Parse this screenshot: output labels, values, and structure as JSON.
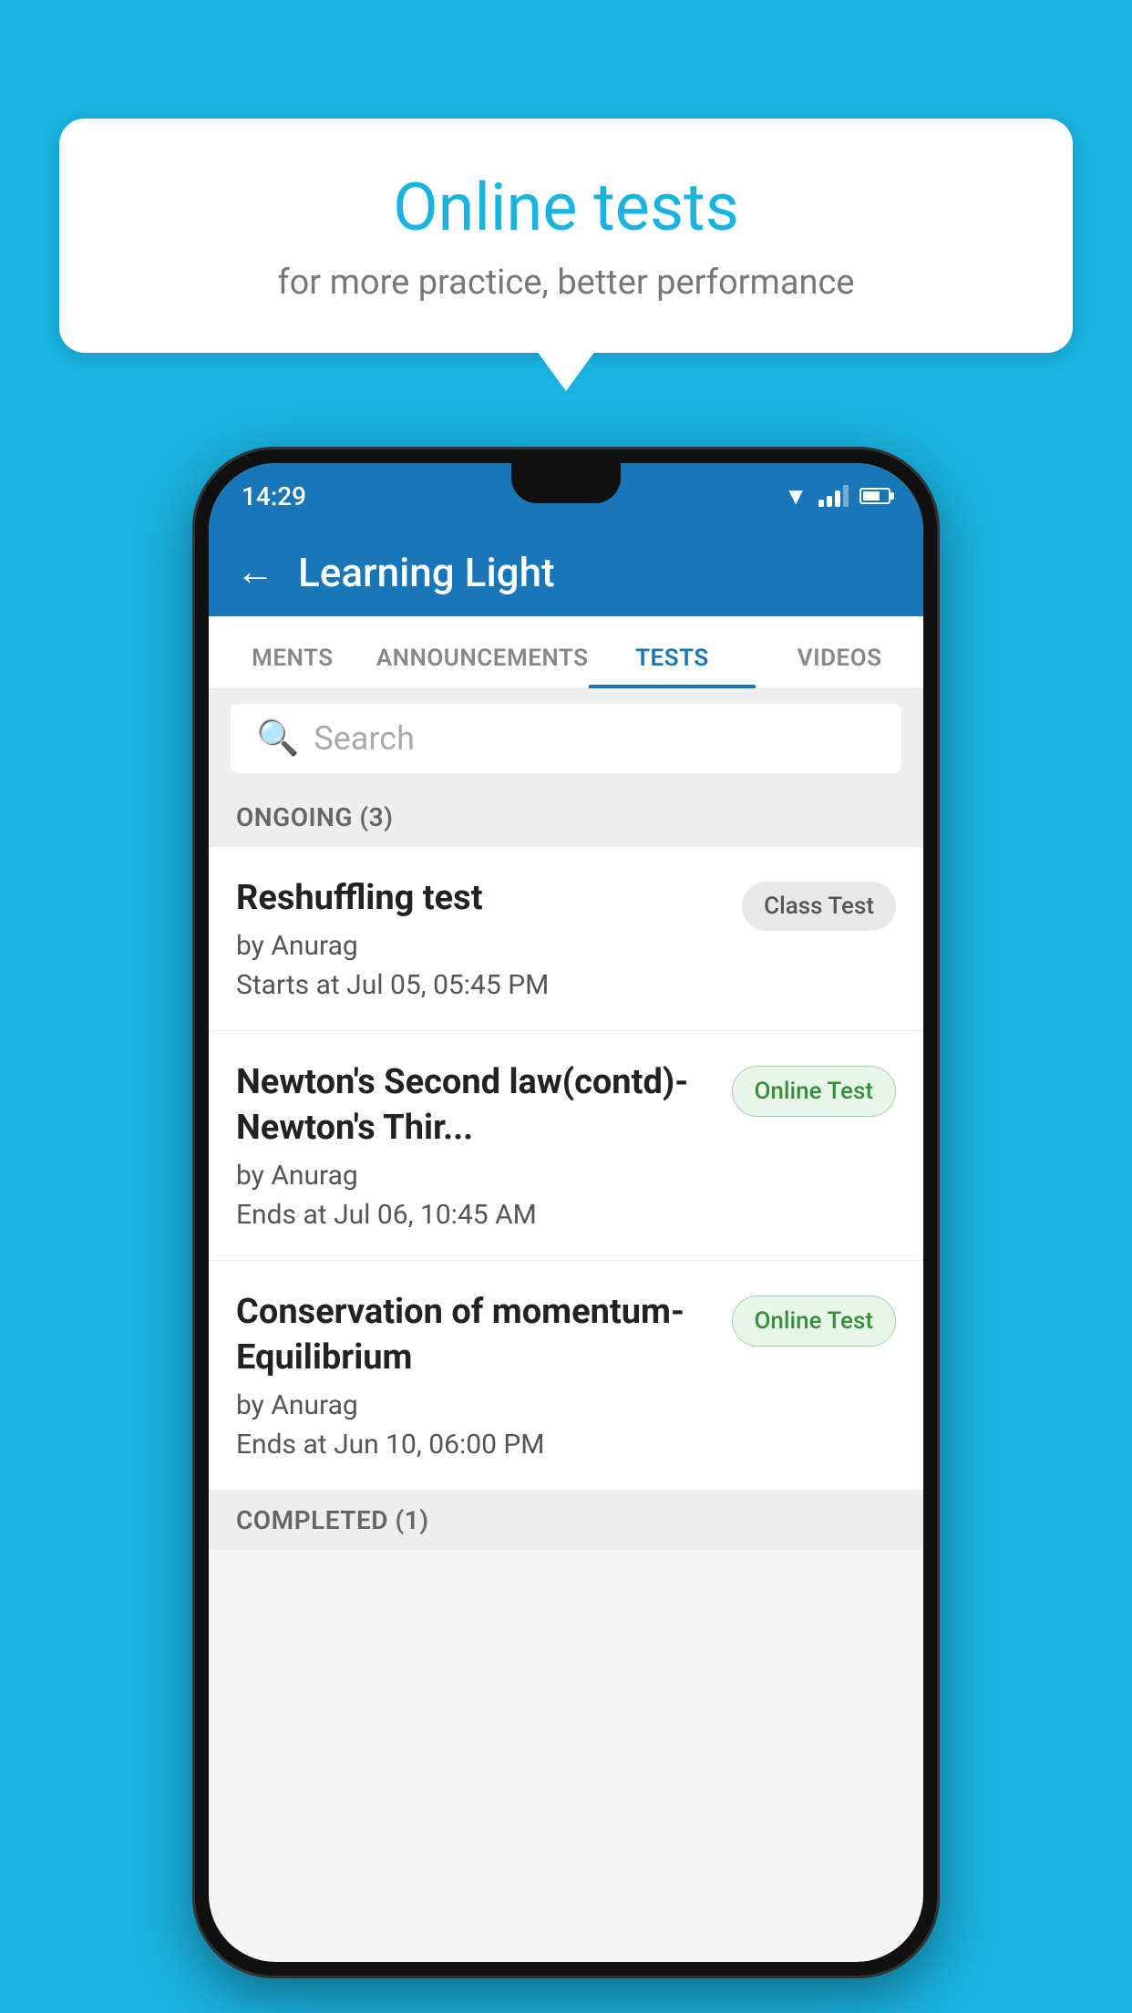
{
  "background_color": "#1ab3e0",
  "speech_bubble": {
    "title": "Online tests",
    "subtitle": "for more practice, better performance"
  },
  "phone": {
    "status_bar": {
      "time": "14:29"
    },
    "app_header": {
      "title": "Learning Light"
    },
    "tabs": [
      {
        "label": "MENTS",
        "active": false
      },
      {
        "label": "ANNOUNCEMENTS",
        "active": false
      },
      {
        "label": "TESTS",
        "active": true
      },
      {
        "label": "VIDEOS",
        "active": false
      }
    ],
    "search": {
      "placeholder": "Search"
    },
    "ongoing_section": {
      "label": "ONGOING (3)"
    },
    "tests": [
      {
        "title": "Reshuffling test",
        "author": "by Anurag",
        "time_label": "Starts at",
        "time": "Jul 05, 05:45 PM",
        "badge": "Class Test",
        "badge_type": "class"
      },
      {
        "title": "Newton's Second law(contd)-Newton's Thir...",
        "author": "by Anurag",
        "time_label": "Ends at",
        "time": "Jul 06, 10:45 AM",
        "badge": "Online Test",
        "badge_type": "online"
      },
      {
        "title": "Conservation of momentum-Equilibrium",
        "author": "by Anurag",
        "time_label": "Ends at",
        "time": "Jun 10, 06:00 PM",
        "badge": "Online Test",
        "badge_type": "online"
      }
    ],
    "completed_section": {
      "label": "COMPLETED (1)"
    }
  }
}
